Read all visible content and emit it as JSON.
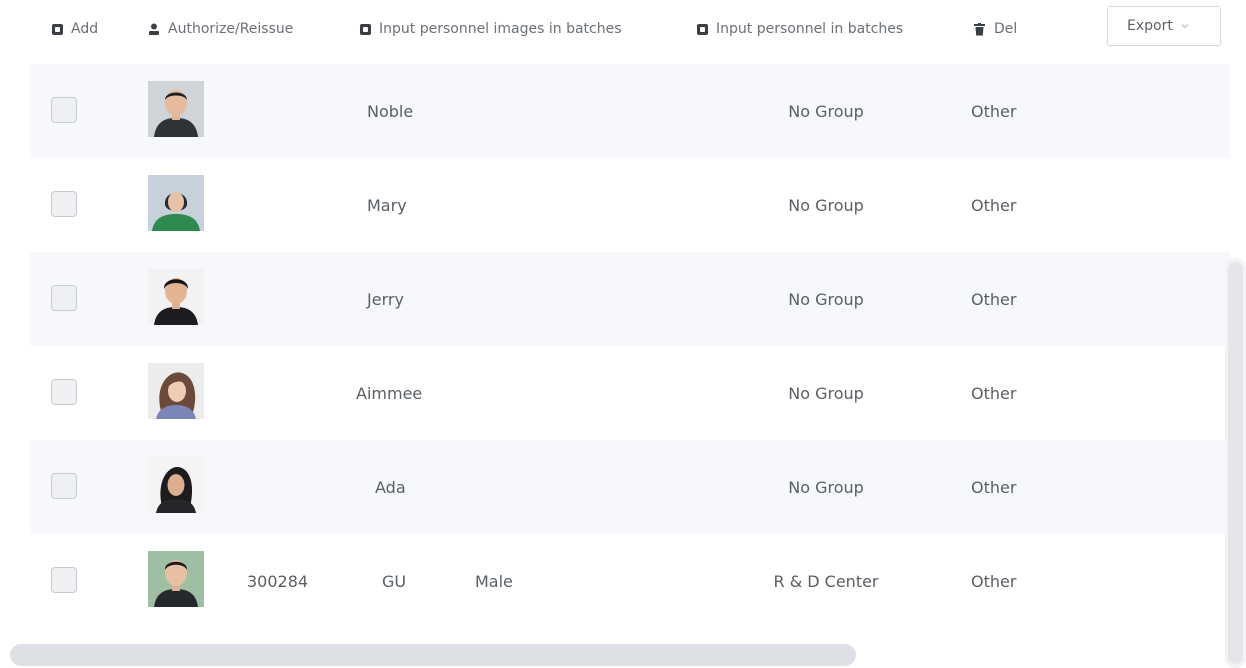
{
  "toolbar": {
    "add_label": "Add",
    "authorize_label": "Authorize/Reissue",
    "input_images_label": "Input personnel images in batches",
    "input_personnel_label": "Input personnel in batches",
    "del_label": "Del",
    "export_label": "Export"
  },
  "rows": [
    {
      "id": "",
      "name": "Noble",
      "gender": "",
      "group": "No Group",
      "type": "Other",
      "avatar_icon": "male-photo-avatar",
      "checked": false
    },
    {
      "id": "",
      "name": "Mary",
      "gender": "",
      "group": "No Group",
      "type": "Other",
      "avatar_icon": "female-photo-avatar",
      "checked": false
    },
    {
      "id": "",
      "name": "Jerry",
      "gender": "",
      "group": "No Group",
      "type": "Other",
      "avatar_icon": "male-photo-avatar",
      "checked": false
    },
    {
      "id": "",
      "name": "Aimmee",
      "gender": "",
      "group": "No Group",
      "type": "Other",
      "avatar_icon": "female-photo-avatar",
      "checked": false
    },
    {
      "id": "",
      "name": "Ada",
      "gender": "",
      "group": "No Group",
      "type": "Other",
      "avatar_icon": "female-photo-avatar",
      "checked": false
    },
    {
      "id": "300284",
      "name": "GU",
      "gender": "Male",
      "group": "R & D Center",
      "type": "Other",
      "avatar_icon": "male-photo-avatar",
      "checked": false
    }
  ],
  "colors": {
    "row_alt_background": "#f6f8fb",
    "icon_dark": "#3a3f45",
    "text": "#5a5f65"
  }
}
